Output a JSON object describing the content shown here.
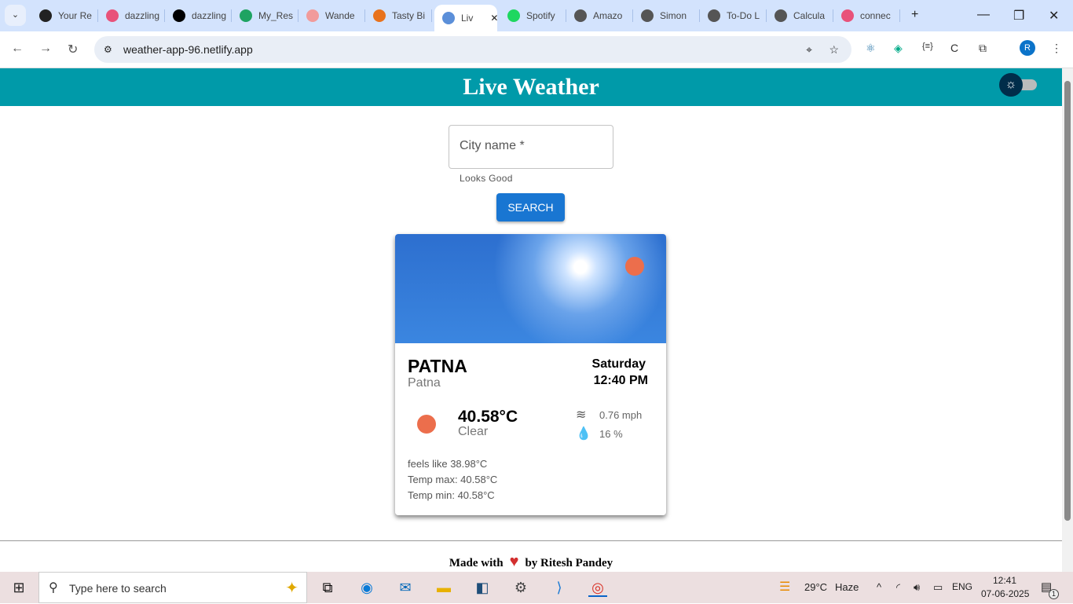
{
  "browser": {
    "tabs": [
      {
        "label": "Your Re",
        "color": "#222"
      },
      {
        "label": "dazzling",
        "color": "#e8527a"
      },
      {
        "label": "dazzling",
        "color": "#000"
      },
      {
        "label": "My_Res",
        "color": "#1ea362"
      },
      {
        "label": "Wande",
        "color": "#f19b9b"
      },
      {
        "label": "Tasty Bi",
        "color": "#e8721c"
      },
      {
        "label": "Liv",
        "color": "#5b8fd9"
      },
      {
        "label": "Spotify",
        "color": "#1ed760"
      },
      {
        "label": "Amazo",
        "color": "#555"
      },
      {
        "label": "Simon",
        "color": "#555"
      },
      {
        "label": "To-Do L",
        "color": "#555"
      },
      {
        "label": "Calcula",
        "color": "#555"
      },
      {
        "label": "connec",
        "color": "#e8527a"
      }
    ],
    "url": "weather-app-96.netlify.app",
    "avatar": "R"
  },
  "app": {
    "title": "Live Weather",
    "city_label": "City name *",
    "helper": "Looks Good",
    "search_label": "SEARCH",
    "card": {
      "city": "PATNA",
      "city_name": "Patna",
      "day": "Saturday",
      "time": "12:40 PM",
      "temp": "40.58°C",
      "description": "Clear",
      "wind": "0.76 mph",
      "humidity": "16 %",
      "feels_like": "feels like 38.98°C",
      "temp_max": "Temp max: 40.58°C",
      "temp_min": "Temp min: 40.58°C"
    },
    "footer": {
      "made_with": "Made with",
      "by": "by Ritesh Pandey"
    },
    "accent": "#009aa9"
  },
  "taskbar": {
    "search_placeholder": "Type here to search",
    "weather": "29°C",
    "weather_desc": "Haze",
    "lang": "ENG",
    "time": "12:41",
    "date": "07-06-2025",
    "notifications": "1"
  }
}
